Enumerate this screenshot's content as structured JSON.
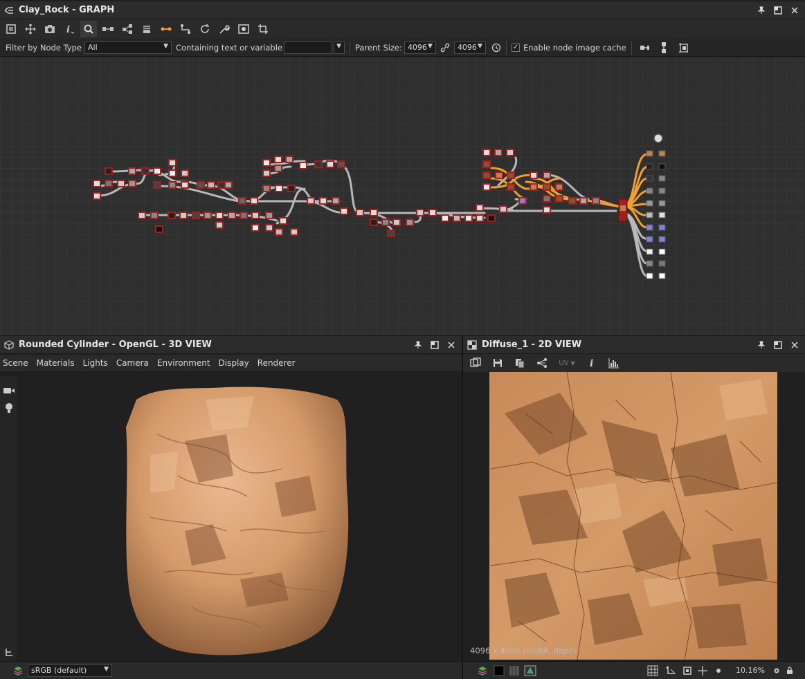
{
  "graph_panel": {
    "title": "Clay_Rock - GRAPH",
    "tools": [
      "frame-all-icon",
      "pan-icon",
      "screenshot-icon",
      "info-icon",
      "search-icon",
      "align-nodes-icon",
      "layout-icon",
      "stack-icon",
      "link-style-icon",
      "elbow-link-icon",
      "refresh-icon",
      "settings-wrench-icon",
      "preview-icon",
      "crop-icon"
    ],
    "filter_label": "Filter by Node Type",
    "filter_value": "All",
    "containing_label": "Containing text or variable",
    "parent_size_label": "Parent Size:",
    "parent_size_w": "4096",
    "parent_size_h": "4096",
    "cache_label": "Enable node image cache",
    "cache_checked": true
  },
  "view3d_panel": {
    "title": "Rounded Cylinder - OpenGL - 3D VIEW",
    "menus": [
      "Scene",
      "Materials",
      "Lights",
      "Camera",
      "Environment",
      "Display",
      "Renderer"
    ],
    "colorspace": "sRGB (default)"
  },
  "view2d_panel": {
    "title": "Diffuse_1 - 2D VIEW",
    "uv_label": "UV",
    "image_info": "4096 x 4096 (RGBA, 8bpc)",
    "zoom": "10.16%"
  },
  "colors": {
    "accent_orange": "#f0a030",
    "link_gray": "#b8b8b8",
    "output_red": "#a02020",
    "clay_light": "#e0a878",
    "clay_dark": "#8a5230"
  }
}
